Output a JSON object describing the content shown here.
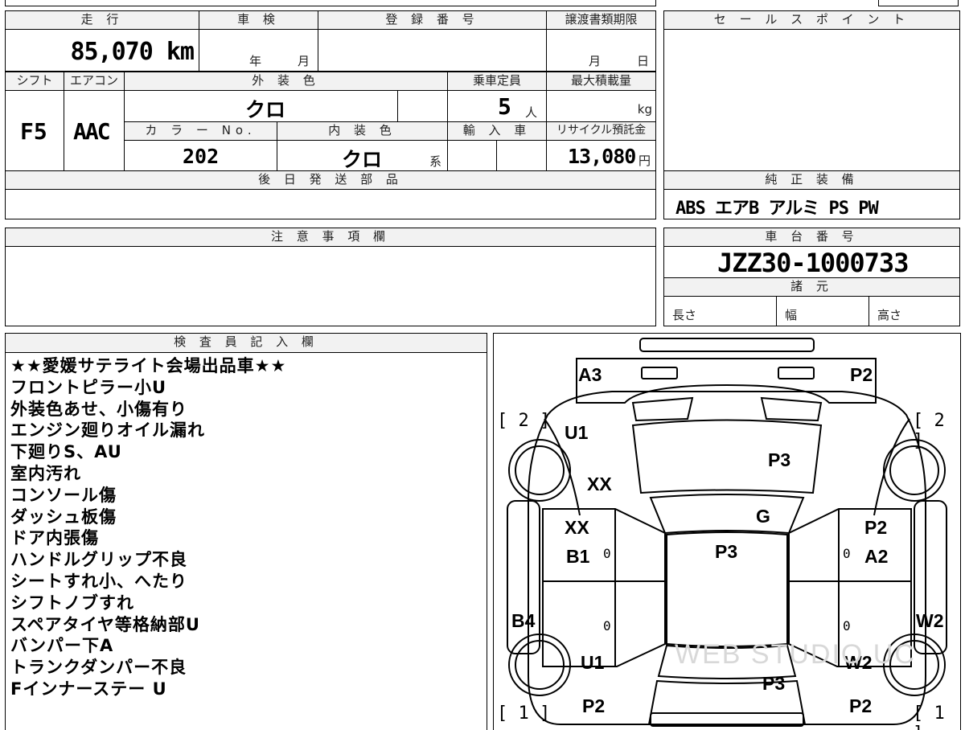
{
  "top_row": {
    "mileage_header": "走 行",
    "mileage_value": "85,070 km",
    "shaken_header": "車 検",
    "shaken_year": "年",
    "shaken_month": "月",
    "reg_header": "登 録 番 号",
    "transfer_header": "譲渡書類期限",
    "transfer_month": "月",
    "transfer_day": "日"
  },
  "row2": {
    "shift_header": "シフト",
    "shift_value": "F5",
    "ac_header": "エアコン",
    "ac_value": "AAC",
    "ext_color_header": "外 装 色",
    "ext_color_value": "クロ",
    "capacity_header": "乗車定員",
    "capacity_value": "5",
    "capacity_unit": "人",
    "max_load_header": "最大積載量",
    "max_load_unit": "kg",
    "color_no_header": "カ ラ ー No.",
    "color_no_value": "202",
    "int_color_header": "内 装 色",
    "int_color_value": "クロ",
    "int_color_unit": "系",
    "import_header": "輸 入 車",
    "recycle_header": "リサイクル預託金",
    "recycle_value": "13,080",
    "recycle_unit": "円"
  },
  "later_parts": {
    "header": "後 日 発 送 部 品"
  },
  "sales_point": {
    "header": "セ ー ル ス ポ イ ン ト"
  },
  "equipment": {
    "header": "純 正 装 備",
    "items": "ABS エアB アルミ PS PW"
  },
  "caution": {
    "header": "注 意 事 項 欄"
  },
  "chassis": {
    "header": "車 台 番 号",
    "value": "JZZ30-1000733"
  },
  "specs": {
    "header": "諸 元",
    "length": "長さ",
    "width": "幅",
    "height": "高さ"
  },
  "inspector": {
    "header": "検 査 員 記 入 欄",
    "notes": [
      "★★愛媛サテライト会場出品車★★",
      "フロントピラー小U",
      "外装色あせ、小傷有り",
      "エンジン廻りオイル漏れ",
      "下廻りS、AU",
      "室内汚れ",
      "コンソール傷",
      "ダッシュ板傷",
      "ドア内張傷",
      "ハンドルグリップ不良",
      "シートすれ小、へたり",
      "シフトノブすれ",
      "スペアタイヤ等格納部U",
      "バンパー下A",
      "トランクダンパー不良",
      "Fインナーステー U"
    ]
  },
  "diagram": {
    "labels": {
      "a3": "A3",
      "p2_tr": "P2",
      "u1_l": "U1",
      "p3_hood": "P3",
      "xx_1": "XX",
      "g": "G",
      "xx_2": "XX",
      "b1": "B1",
      "p3_roof": "P3",
      "p2_rd": "P2",
      "a2": "A2",
      "b4": "B4",
      "w2_r": "W2",
      "u1_bl": "U1",
      "w2_br": "W2",
      "p3_trunk": "P3",
      "p2_bl": "P2",
      "p2_br": "P2"
    },
    "zeros": [
      "0",
      "0",
      "0",
      "0"
    ],
    "brackets": {
      "front_left": "[ 2 ]",
      "front_right": "[ 2 ]",
      "rear_left": "[ 1 ]",
      "rear_right": "[ 1 ]"
    },
    "watermark": "WEB STUDIO UC"
  }
}
